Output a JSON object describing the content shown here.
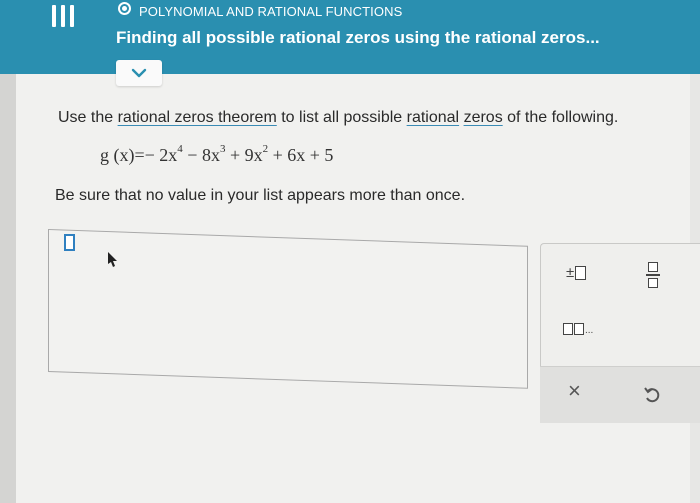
{
  "header": {
    "menu_icon": "hamburger-menu-icon",
    "topic": "POLYNOMIAL AND RATIONAL FUNCTIONS",
    "title": "Finding all possible rational zeros using the rational zeros...",
    "expand_icon": "chevron-down-icon",
    "colors": {
      "bar": "#2a8fb0",
      "text": "#ffffff"
    }
  },
  "question": {
    "prefix": "Use the ",
    "link_theorem": "rational zeros theorem",
    "middle": " to list all possible ",
    "link_rational": "rational",
    "space": " ",
    "link_zeros": "zeros",
    "suffix": " of the following.",
    "equation": {
      "lhs": "g (x)=",
      "t1": "− 2x",
      "e1": "4",
      "t2": " − 8x",
      "e2": "3",
      "t3": " + 9x",
      "e3": "2",
      "t4": " + 6x + 5"
    },
    "note": "Be sure that no value in your list appears more than once."
  },
  "answer": {
    "value": "",
    "slot_color": "#2f80c0"
  },
  "keypad": {
    "plus_minus": "±",
    "list_dots": "...",
    "clear_symbol": "×",
    "keys": [
      "plus-minus-key",
      "fraction-key",
      "list-key",
      "clear-key",
      "undo-key"
    ]
  }
}
